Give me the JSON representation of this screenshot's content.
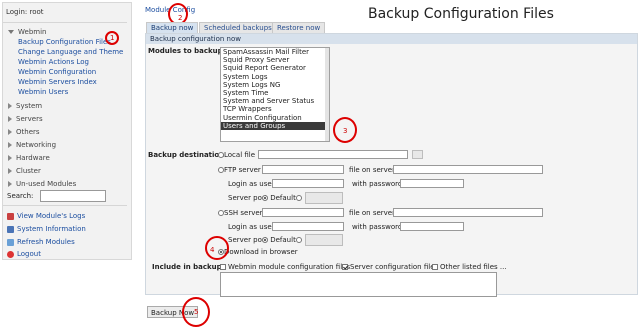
{
  "sidebar": {
    "login": "Login: root",
    "module_group": "Webmin",
    "links": [
      "Backup Configuration Files",
      "Change Language and Theme",
      "Webmin Actions Log",
      "Webmin Configuration",
      "Webmin Servers Index",
      "Webmin Users"
    ],
    "categories": [
      "System",
      "Servers",
      "Others",
      "Networking",
      "Hardware",
      "Cluster",
      "Un-used Modules"
    ],
    "search_label": "Search:",
    "bottom_links": [
      "View Module's Logs",
      "System Information",
      "Refresh Modules",
      "Logout"
    ]
  },
  "header": {
    "module_config": "Module Config",
    "title": "Backup Configuration Files"
  },
  "tabs": [
    "Backup now",
    "Scheduled backups",
    "Restore now"
  ],
  "panel": {
    "heading": "Backup configuration now",
    "modules_label": "Modules to backup",
    "modules": [
      "SpamAssassin Mail Filter",
      "Squid Proxy Server",
      "Squid Report Generator",
      "System Logs",
      "System Logs NG",
      "System Time",
      "System and Server Status",
      "TCP Wrappers",
      "Usermin Configuration",
      "Users and Groups"
    ],
    "selected_module": "Users and Groups",
    "destination_label": "Backup destination",
    "local_file": "Local file",
    "ftp_server": "FTP server",
    "file_on_server": "file on server",
    "login_as_user": "Login as user",
    "with_password": "with password",
    "server_port": "Server port",
    "default": "Default",
    "ssh_server": "SSH server",
    "download": "Download in browser",
    "include_label": "Include in backup",
    "include_options": [
      "Webmin module configuration files",
      "Server configuration files",
      "Other listed files ..."
    ],
    "backup_button": "Backup Now"
  },
  "annotations": [
    "1",
    "2",
    "3",
    "4",
    "5"
  ]
}
